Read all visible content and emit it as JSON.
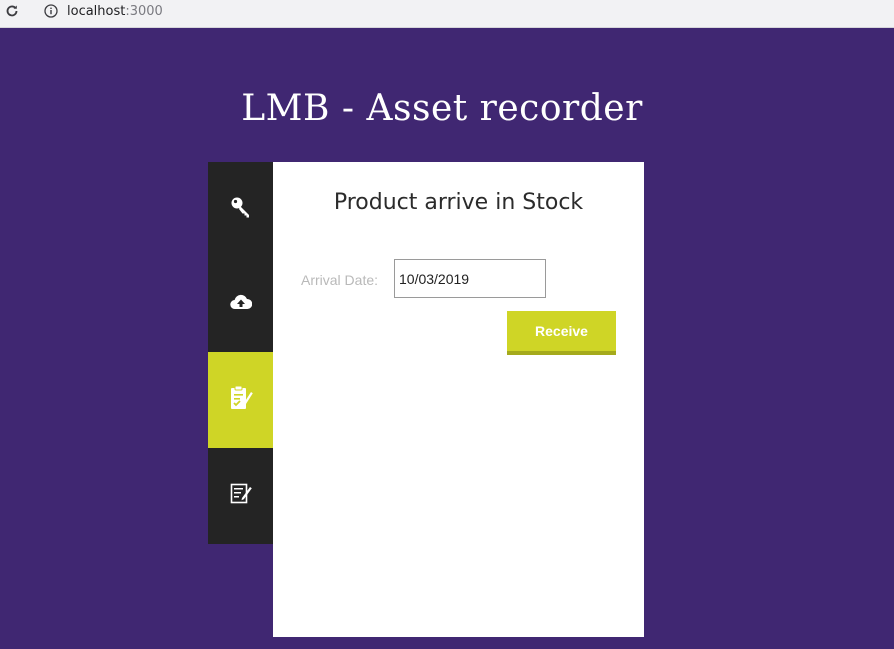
{
  "browser": {
    "url_host": "localhost",
    "url_port": ":3000"
  },
  "app": {
    "title": "LMB - Asset recorder"
  },
  "sidebar": {
    "items": [
      {
        "icon": "key-icon",
        "active": false
      },
      {
        "icon": "cloud-upload-icon",
        "active": false
      },
      {
        "icon": "clipboard-check-icon",
        "active": true
      },
      {
        "icon": "edit-list-icon",
        "active": false
      }
    ],
    "active_color": "#cfd526",
    "background": "#242424"
  },
  "panel": {
    "title": "Product arrive in Stock",
    "arrival_date_label": "Arrival Date:",
    "arrival_date_value": "10/03/2019",
    "receive_label": "Receive"
  },
  "colors": {
    "page_background": "#402772",
    "accent": "#cfd526"
  }
}
